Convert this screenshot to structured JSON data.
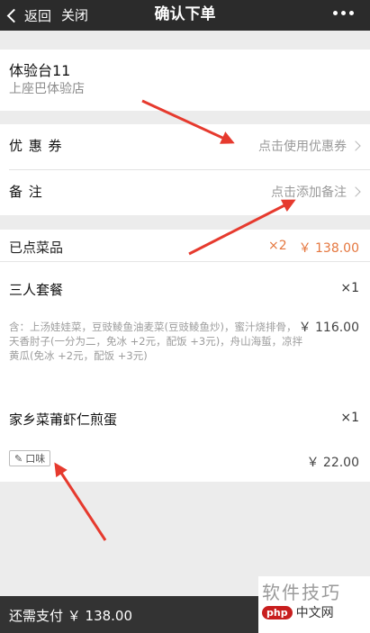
{
  "nav": {
    "back_label": "返回",
    "close_label": "关闭",
    "title": "确认下单"
  },
  "store": {
    "name": "体验台11",
    "address": "上座巴体验店"
  },
  "options": {
    "coupon": {
      "label": "优 惠 券",
      "value": "点击使用优惠券"
    },
    "note": {
      "label": "备    注",
      "value": "点击添加备注"
    }
  },
  "order": {
    "header_label": "已点菜品",
    "total_qty": "×2",
    "total_price": "￥ 138.00",
    "items": [
      {
        "name": "三人套餐",
        "qty": "×1",
        "desc": "含：上汤娃娃菜，豆豉鲮鱼油麦菜(豆豉鲮鱼炒)，蜜汁烧排骨，天香肘子(一分为二，免冰 +2元，配饭 +3元)，舟山海蜇，凉拌黄瓜(免冰 +2元，配饭 +3元)",
        "price": "￥ 116.00"
      },
      {
        "name": "家乡菜莆虾仁煎蛋",
        "qty": "×1",
        "taste_label": "口味",
        "price": "￥ 22.00"
      }
    ]
  },
  "footer": {
    "pay_label": "还需支付 ￥ 138.00"
  },
  "watermark": {
    "line1": "软件技巧",
    "logo": "php",
    "cn": "中文网"
  },
  "colors": {
    "accent": "#e5773f",
    "arrow": "#e63a2e",
    "nav_bg": "#2b2b2b"
  },
  "icons": {
    "back": "chevron-left-icon",
    "more": "more-dots-icon",
    "arrow": "chevron-right-icon",
    "taste": "pencil-icon"
  }
}
